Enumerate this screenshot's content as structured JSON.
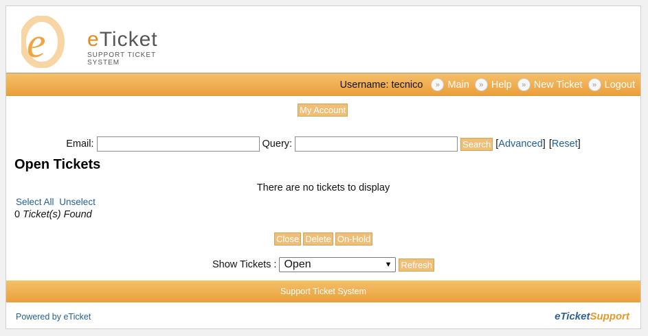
{
  "header": {
    "logo_title_e": "e",
    "logo_title_rest": "Ticket",
    "logo_subtitle": "SUPPORT TICKET SYSTEM"
  },
  "topbar": {
    "username_label": "Username: tecnico",
    "nav": [
      "Main",
      "Help",
      "New Ticket",
      "Logout"
    ]
  },
  "account_button": "My Account",
  "search": {
    "email_label": "Email:",
    "email_value": "",
    "query_label": "Query:",
    "query_value": "",
    "search_button": "Search",
    "advanced_link": "Advanced",
    "reset_link": "Reset"
  },
  "main": {
    "title": "Open Tickets",
    "empty_message": "There are no tickets to display",
    "select_all": "Select All",
    "unselect": "Unselect",
    "found_count": "0",
    "found_text": "Ticket(s) Found"
  },
  "actions": [
    "Close",
    "Delete",
    "On-Hold"
  ],
  "show": {
    "label": "Show Tickets :",
    "selected": "Open",
    "refresh": "Refresh"
  },
  "footer": {
    "title": "Support Ticket System",
    "powered_by": "Powered by eTicket",
    "brand_e": "e",
    "brand_ticket": "Ticket",
    "brand_support": "Support"
  },
  "colors": {
    "accent": "#e9a03b",
    "link": "#1f5f95",
    "button": "#efbe77"
  }
}
